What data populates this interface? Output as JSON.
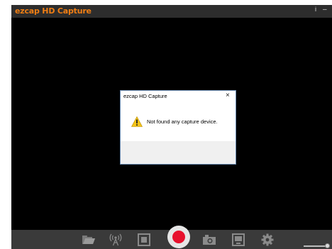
{
  "window": {
    "title": "ezcap HD Capture",
    "info_label": "i",
    "minimize_label": "–"
  },
  "toolbar": {
    "items": [
      {
        "name": "open-folder",
        "icon": "folder-icon"
      },
      {
        "name": "broadcast",
        "icon": "broadcast-icon"
      },
      {
        "name": "fullscreen",
        "icon": "fullscreen-icon"
      },
      {
        "name": "record",
        "icon": "record-icon"
      },
      {
        "name": "snapshot",
        "icon": "camera-icon"
      },
      {
        "name": "display",
        "icon": "screen-icon"
      },
      {
        "name": "settings",
        "icon": "gear-icon"
      }
    ],
    "volume_level": 1.0
  },
  "dialog": {
    "title": "ezcap HD Capture",
    "close_label": "×",
    "icon": "warning-icon",
    "message": "Not found any capture device."
  },
  "colors": {
    "accent": "#f07e14",
    "record": "#e8112d",
    "warning": "#f5c518"
  }
}
